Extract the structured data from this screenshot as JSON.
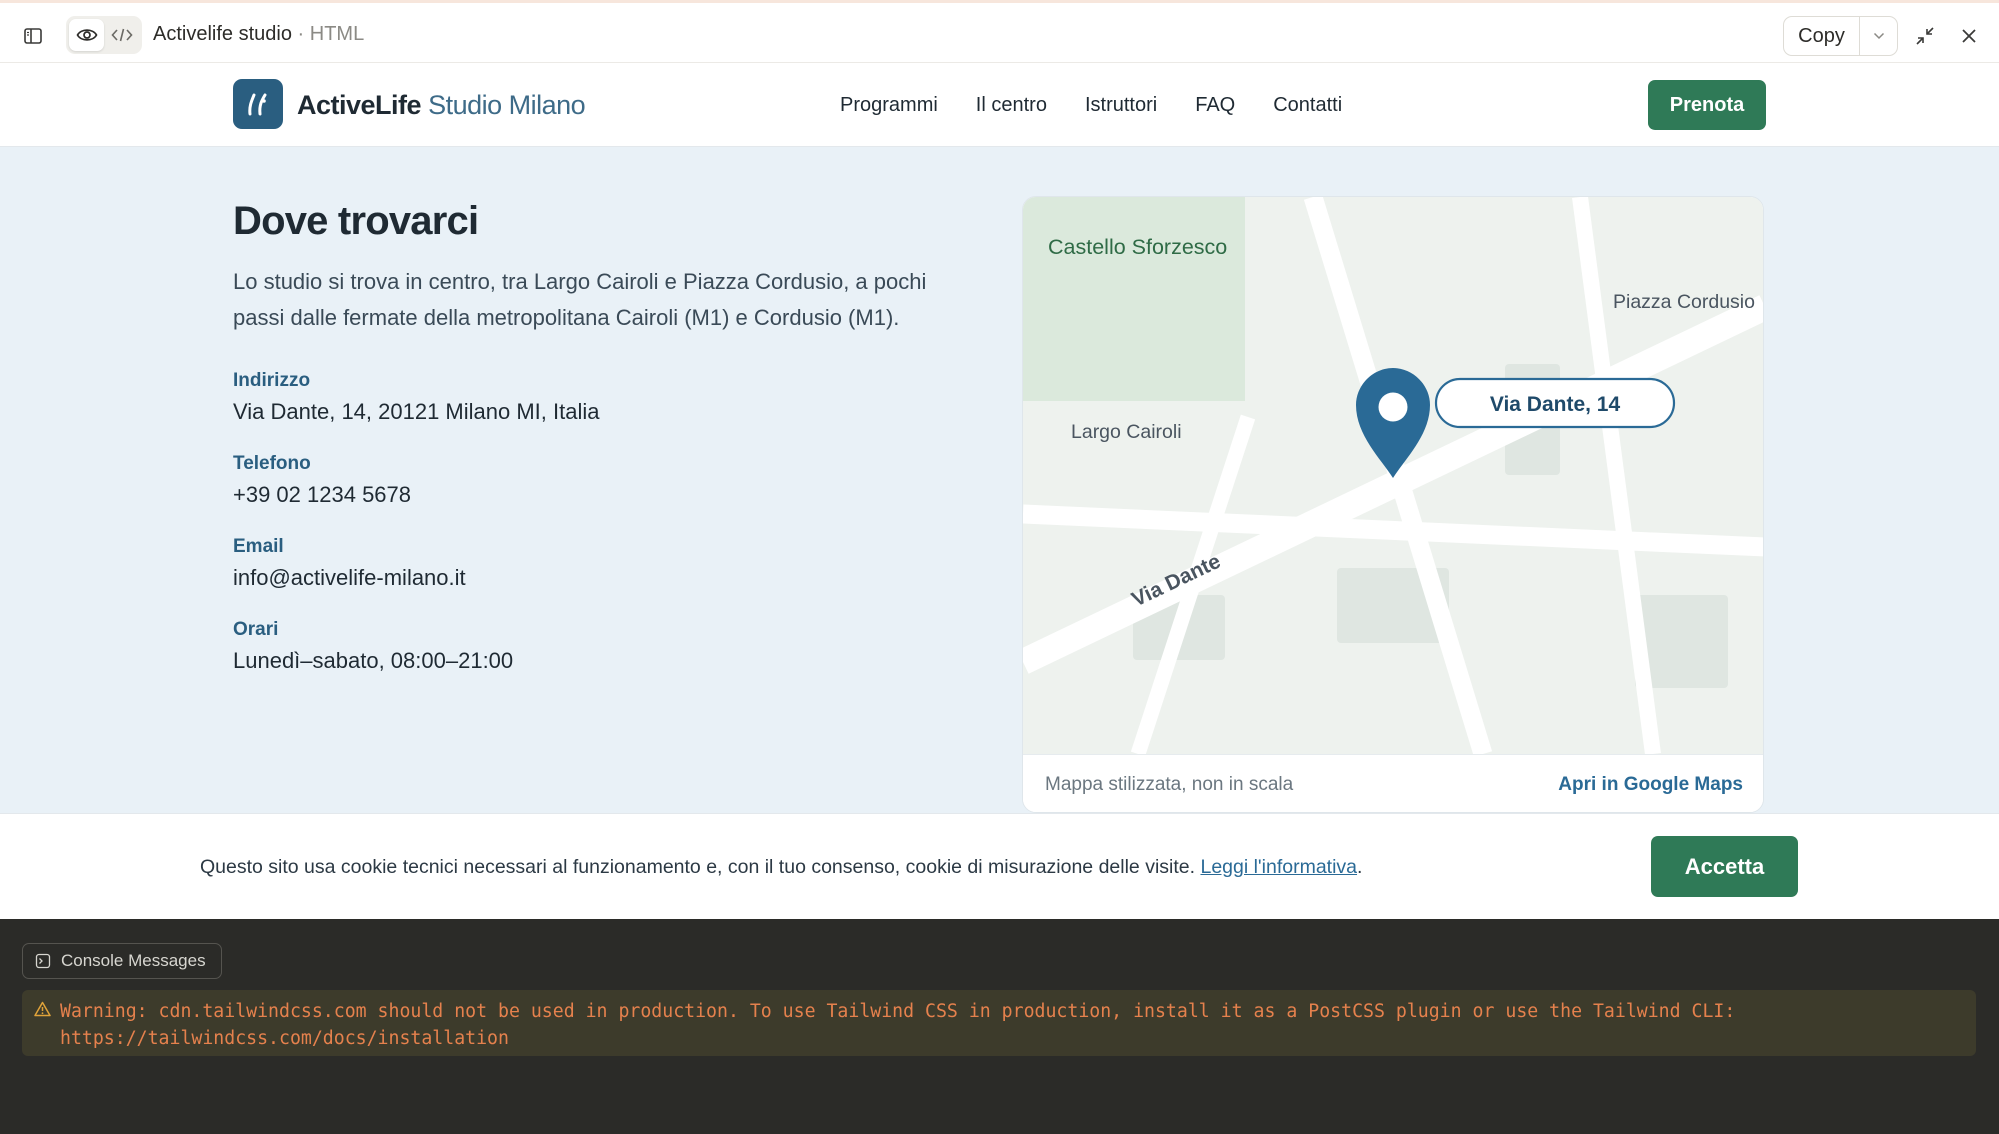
{
  "artifact_bar": {
    "title": "Activelife studio",
    "separator": "·",
    "file_type": "HTML",
    "copy_label": "Copy"
  },
  "site": {
    "brand_bold": "ActiveLife",
    "brand_light": "Studio Milano",
    "nav": [
      "Programmi",
      "Il centro",
      "Istruttori",
      "FAQ",
      "Contatti"
    ],
    "cta": "Prenota",
    "colors": {
      "primary": "#2a5e80",
      "accent_green": "#2f7a57",
      "section_bg": "#e9f1f7"
    }
  },
  "location": {
    "heading": "Dove trovarci",
    "intro": "Lo studio si trova in centro, tra Largo Cairoli e Piazza Cordusio, a pochi passi dalle fermate della metropolitana Cairoli (M1) e Cordusio (M1).",
    "info": [
      {
        "label": "Indirizzo",
        "value": "Via Dante, 14, 20121 Milano MI, Italia"
      },
      {
        "label": "Telefono",
        "value": "+39 02 1234 5678"
      },
      {
        "label": "Email",
        "value": "info@activelife-milano.it"
      },
      {
        "label": "Orari",
        "value": "Lunedì–sabato, 08:00–21:00"
      }
    ]
  },
  "map": {
    "labels": {
      "castello": "Castello Sforzesco",
      "cordusio": "Piazza Cordusio",
      "cairoli": "Largo Cairoli",
      "street": "Via Dante",
      "pin": "Via Dante, 14"
    },
    "note": "Mappa stilizzata, non in scala",
    "link": "Apri in Google Maps"
  },
  "cookie": {
    "text": "Questo sito usa cookie tecnici necessari al funzionamento e, con il tuo consenso, cookie di misurazione delle visite.",
    "link": "Leggi l'informativa",
    "end": ".",
    "button": "Accetta"
  },
  "console": {
    "tab_label": "Console Messages",
    "warning": "Warning: cdn.tailwindcss.com should not be used in production. To use Tailwind CSS in production, install it as a PostCSS plugin or use the Tailwind CLI: https://tailwindcss.com/docs/installation"
  }
}
